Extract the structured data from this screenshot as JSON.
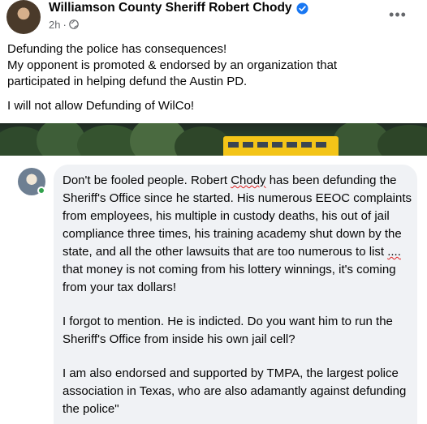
{
  "post": {
    "author": "Williamson County Sheriff Robert Chody",
    "timestamp": "2h",
    "audience_icon": "globe-icon",
    "verified_icon": "verified-badge-icon",
    "more_label": "•••",
    "body_lines": [
      "Defunding the police has consequences!",
      "My opponent is promoted & endorsed by an organization that",
      "participated in helping defund the Austin PD."
    ],
    "closing_line": "I will not allow Defunding of WilCo!"
  },
  "comment": {
    "paragraph1_a": "Don't be fooled people. Robert ",
    "paragraph1_chody": "Chody",
    "paragraph1_b": " has been defunding the Sheriff's Office since he started. His numerous EEOC complaints from employees, his multiple in custody deaths, his out of jail compliance three times, his training academy shut down by the state, and all the other lawsuits that are too numerous to list ",
    "paragraph1_dots": "....",
    "paragraph1_c": " that money is not coming from his lottery winnings, it's coming from your tax dollars!",
    "paragraph2": "I forgot to mention. He is indicted. Do you want him to run the Sheriff's Office from inside his own jail cell?",
    "paragraph3": "I am also endorsed and supported by TMPA, the largest police association in Texas, who are also adamantly against defunding the police\""
  },
  "colors": {
    "verified": "#1877f2",
    "secondary_text": "#65676b",
    "comment_bg": "#f0f2f5",
    "online": "#31a24c"
  }
}
